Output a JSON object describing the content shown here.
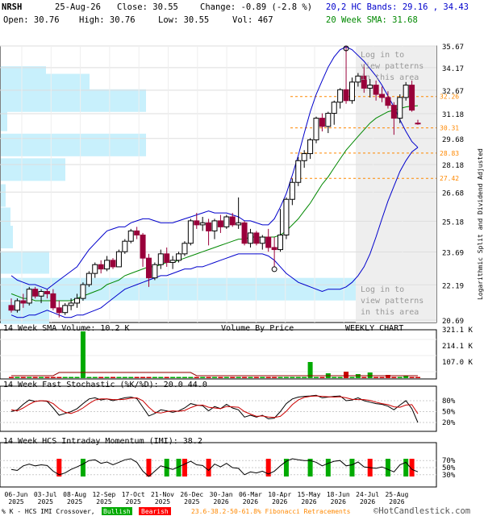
{
  "header": {
    "symbol": "NRSH",
    "date": "25-Aug-26",
    "close_label": "Close: 30.55",
    "change_label": "Change: -0.89 (-2.8 %)",
    "bands_label": "20,2 HC Bands: 29.16 , 34.43",
    "open_label": "Open: 30.76",
    "high_label": "High: 30.76",
    "low_label": "Low: 30.55",
    "vol_label": "Vol: 467",
    "sma_label": "20 Week SMA: 31.68"
  },
  "panels": {
    "volume_title": "14 Week SMA Volume: 10.2 K",
    "vbp_label": "Volume By Price",
    "weekly_label": "WEEKLY CHART",
    "stoch_title": "14 Week Fast Stochastic (%K/%D): 20.0 44.0",
    "imi_title": "14 Week HCS Intraday Momentum (IMI): 38.2",
    "side_label": "Logarithmic    Split and Dividend Adjusted",
    "login_top": [
      "Log in to",
      "view patterns",
      "in this area"
    ],
    "login_bottom": [
      "Log in to",
      "view patterns",
      "in this area"
    ]
  },
  "footer": {
    "legend_prefix": "% K - HCS IMI Crossover,",
    "bullish": "Bullish",
    "bearish": "Bearish",
    "fib": "23.6-38.2-50-61.8% Fibonacci Retracements",
    "copyright": "©HotCandlestick.com"
  },
  "colors": {
    "up_candle": "#ffffff",
    "down_candle": "#99003a",
    "bands": "#0000cc",
    "sma": "#008800",
    "vbp": "#c8f0fc",
    "fib": "#ff8800",
    "bullish": "#00aa00",
    "bearish": "#ff0000"
  },
  "chart_data": {
    "type": "candlestick",
    "scale": "log",
    "ylim": [
      20.69,
      35.67
    ],
    "price_ticks": [
      "35.67",
      "34.17",
      "32.67",
      "31.18",
      "29.68",
      "28.18",
      "26.68",
      "25.18",
      "23.69",
      "22.19",
      "20.69"
    ],
    "fib_levels": [
      {
        "label": "32.26",
        "value": 32.26
      },
      {
        "label": "30.31",
        "value": 30.31
      },
      {
        "label": "28.83",
        "value": 28.83
      },
      {
        "label": "27.42",
        "value": 27.42
      }
    ],
    "x_labels": [
      "06-Jun\n2025",
      "03-Jul\n2025",
      "08-Aug\n2025",
      "12-Sep\n2025",
      "17-Oct\n2025",
      "21-Nov\n2025",
      "26-Dec\n2025",
      "30-Jan\n2026",
      "06-Mar\n2026",
      "10-Apr\n2026",
      "15-May\n2026",
      "18-Jun\n2026",
      "24-Jul\n2026",
      "25-Aug\n2026"
    ],
    "candles": [
      [
        21.3,
        21.6,
        21.0,
        21.1
      ],
      [
        21.1,
        21.6,
        21.0,
        21.5
      ],
      [
        21.5,
        21.8,
        21.2,
        21.4
      ],
      [
        21.4,
        22.1,
        21.3,
        22.0
      ],
      [
        22.0,
        22.1,
        21.6,
        21.7
      ],
      [
        21.7,
        22.0,
        21.4,
        21.9
      ],
      [
        21.9,
        22.0,
        21.6,
        21.8
      ],
      [
        21.8,
        22.0,
        21.1,
        21.2
      ],
      [
        21.2,
        21.5,
        20.8,
        21.0
      ],
      [
        21.0,
        21.4,
        20.9,
        21.3
      ],
      [
        21.3,
        21.6,
        21.1,
        21.4
      ],
      [
        21.4,
        21.8,
        21.2,
        21.6
      ],
      [
        21.6,
        22.3,
        21.5,
        22.2
      ],
      [
        22.2,
        22.8,
        22.1,
        22.7
      ],
      [
        22.7,
        23.2,
        22.5,
        23.1
      ],
      [
        23.1,
        23.3,
        22.7,
        22.9
      ],
      [
        22.9,
        23.5,
        22.8,
        23.3
      ],
      [
        23.3,
        23.4,
        22.9,
        23.0
      ],
      [
        23.0,
        23.8,
        23.0,
        23.7
      ],
      [
        23.7,
        24.3,
        23.6,
        24.2
      ],
      [
        24.2,
        24.8,
        24.1,
        24.7
      ],
      [
        24.7,
        24.9,
        24.3,
        24.5
      ],
      [
        24.5,
        24.6,
        23.0,
        23.4
      ],
      [
        23.4,
        23.6,
        22.1,
        22.5
      ],
      [
        22.5,
        23.2,
        22.4,
        23.1
      ],
      [
        23.1,
        23.8,
        22.9,
        23.6
      ],
      [
        23.6,
        23.9,
        23.0,
        23.2
      ],
      [
        23.2,
        23.5,
        22.9,
        23.3
      ],
      [
        23.3,
        23.7,
        23.2,
        23.6
      ],
      [
        23.6,
        24.2,
        23.5,
        24.1
      ],
      [
        24.1,
        25.3,
        24.0,
        25.2
      ],
      [
        25.2,
        25.6,
        24.8,
        25.0
      ],
      [
        25.0,
        25.4,
        24.7,
        25.1
      ],
      [
        25.1,
        25.3,
        24.0,
        24.7
      ],
      [
        24.7,
        25.3,
        24.3,
        25.2
      ],
      [
        25.2,
        25.5,
        24.6,
        24.9
      ],
      [
        24.9,
        25.5,
        24.8,
        25.4
      ],
      [
        25.4,
        25.6,
        24.9,
        25.0
      ],
      [
        25.0,
        26.4,
        24.8,
        25.1
      ],
      [
        25.1,
        25.2,
        24.0,
        24.1
      ],
      [
        24.1,
        24.8,
        23.9,
        24.6
      ],
      [
        24.6,
        24.7,
        24.0,
        24.1
      ],
      [
        24.1,
        24.5,
        23.8,
        24.4
      ],
      [
        24.4,
        24.8,
        23.7,
        23.9
      ],
      [
        23.9,
        24.4,
        23.0,
        23.8
      ],
      [
        23.8,
        25.8,
        23.7,
        24.5
      ],
      [
        24.5,
        26.4,
        24.3,
        26.3
      ],
      [
        26.3,
        27.4,
        26.0,
        27.2
      ],
      [
        27.2,
        28.6,
        27.0,
        28.4
      ],
      [
        28.4,
        29.0,
        28.0,
        28.8
      ],
      [
        28.8,
        29.7,
        28.5,
        29.6
      ],
      [
        29.6,
        31.0,
        29.4,
        30.9
      ],
      [
        30.9,
        31.2,
        30.1,
        30.4
      ],
      [
        30.4,
        31.3,
        30.0,
        31.2
      ],
      [
        31.2,
        32.0,
        30.5,
        31.9
      ],
      [
        31.9,
        32.8,
        31.5,
        32.7
      ],
      [
        32.7,
        35.67,
        31.8,
        32.0
      ],
      [
        32.0,
        33.5,
        31.8,
        33.2
      ],
      [
        33.2,
        33.8,
        32.9,
        33.6
      ],
      [
        33.6,
        34.4,
        32.5,
        32.8
      ],
      [
        32.8,
        33.4,
        32.2,
        33.0
      ],
      [
        33.0,
        33.3,
        32.0,
        32.4
      ],
      [
        32.4,
        32.9,
        31.9,
        32.2
      ],
      [
        32.2,
        32.6,
        31.5,
        31.7
      ],
      [
        31.7,
        31.9,
        29.9,
        30.9
      ],
      [
        30.9,
        32.4,
        30.6,
        32.2
      ],
      [
        32.2,
        33.2,
        32.0,
        33.0
      ],
      [
        33.0,
        33.3,
        31.3,
        31.4
      ],
      [
        30.6,
        30.8,
        30.5,
        30.55
      ]
    ],
    "upper_band": [
      22.6,
      22.4,
      22.3,
      22.2,
      22.2,
      22.1,
      22.0,
      22.2,
      22.4,
      22.6,
      22.8,
      23.0,
      23.4,
      23.8,
      24.1,
      24.4,
      24.7,
      24.8,
      24.9,
      24.9,
      25.1,
      25.2,
      25.3,
      25.3,
      25.2,
      25.1,
      25.1,
      25.1,
      25.2,
      25.3,
      25.4,
      25.5,
      25.6,
      25.7,
      25.6,
      25.6,
      25.6,
      25.5,
      25.4,
      25.2,
      25.2,
      25.1,
      25.0,
      25.0,
      25.3,
      25.9,
      26.6,
      27.6,
      28.7,
      30.0,
      31.3,
      32.4,
      33.3,
      34.2,
      34.9,
      35.4,
      35.6,
      35.4,
      35.0,
      34.6,
      34.1,
      33.6,
      33.0,
      32.3,
      31.6,
      30.8,
      30.1,
      29.5,
      29.16
    ],
    "sma20": [
      21.8,
      21.7,
      21.6,
      21.6,
      21.5,
      21.5,
      21.5,
      21.5,
      21.5,
      21.5,
      21.5,
      21.6,
      21.7,
      21.8,
      21.9,
      22.0,
      22.2,
      22.3,
      22.4,
      22.6,
      22.7,
      22.8,
      22.9,
      23.0,
      23.0,
      23.1,
      23.2,
      23.2,
      23.3,
      23.4,
      23.5,
      23.6,
      23.7,
      23.8,
      23.9,
      24.0,
      24.1,
      24.2,
      24.3,
      24.3,
      24.4,
      24.4,
      24.4,
      24.4,
      24.4,
      24.5,
      24.7,
      25.0,
      25.3,
      25.7,
      26.1,
      26.6,
      27.1,
      27.5,
      28.0,
      28.5,
      29.0,
      29.4,
      29.8,
      30.2,
      30.6,
      30.9,
      31.1,
      31.3,
      31.4,
      31.5,
      31.6,
      31.65,
      31.68
    ],
    "lower_band": [
      20.9,
      20.8,
      20.8,
      20.9,
      20.9,
      21.0,
      21.1,
      21.0,
      20.9,
      20.8,
      20.8,
      20.9,
      20.9,
      21.0,
      21.1,
      21.2,
      21.4,
      21.6,
      21.8,
      22.0,
      22.1,
      22.2,
      22.3,
      22.4,
      22.5,
      22.6,
      22.6,
      22.7,
      22.8,
      22.9,
      22.9,
      23.0,
      23.0,
      23.1,
      23.2,
      23.3,
      23.4,
      23.5,
      23.6,
      23.6,
      23.6,
      23.6,
      23.6,
      23.5,
      23.3,
      23.0,
      22.7,
      22.5,
      22.3,
      22.2,
      22.1,
      22.0,
      21.9,
      22.0,
      22.0,
      22.0,
      22.1,
      22.3,
      22.6,
      23.0,
      23.6,
      24.4,
      25.3,
      26.2,
      27.0,
      27.8,
      28.4,
      28.9,
      29.16
    ],
    "vbp_bars": [
      {
        "price": 33.5,
        "len": 56
      },
      {
        "price": 33.0,
        "len": 110
      },
      {
        "price": 32.0,
        "len": 180
      },
      {
        "price": 30.8,
        "len": 8
      },
      {
        "price": 29.3,
        "len": 180
      },
      {
        "price": 27.9,
        "len": 80
      },
      {
        "price": 26.5,
        "len": 6
      },
      {
        "price": 25.3,
        "len": 12
      },
      {
        "price": 24.4,
        "len": 15
      },
      {
        "price": 23.2,
        "len": 60
      },
      {
        "price": 22.0,
        "len": 440
      },
      {
        "price": 21.0,
        "len": 60
      }
    ],
    "volume": [
      1.5,
      1.5,
      1.5,
      1.5,
      1.5,
      1.5,
      1.5,
      1.5,
      1.5,
      1.5,
      1.5,
      1.5,
      1.5,
      1.5,
      1.5,
      1.5,
      1.5,
      1.5,
      1.5,
      1.5,
      1.5,
      1.5,
      1.5,
      1.5,
      1.5,
      1.5,
      1.5,
      1.5,
      1.5,
      1.5,
      1.5,
      1.5,
      1.5,
      1.5,
      1.5,
      1.5,
      1.5,
      1.5,
      1.5,
      1.5,
      1.5,
      1.5,
      1.5,
      1.5,
      1.5,
      1.5,
      1.5,
      1.5,
      1.5,
      1.5,
      1.5,
      1.5,
      1.5,
      1.5,
      1.5,
      1.5,
      1.5,
      1.5,
      1.5,
      1.5,
      1.5,
      1.5,
      1.5,
      1.5,
      1.5,
      1.5,
      1.5,
      1.5,
      1.5
    ],
    "volume_ticks": [
      "321.1 K",
      "214.1 K",
      "107.0 K"
    ],
    "stoch_ticks": [
      "80%",
      "50%",
      "20%"
    ],
    "stoch_k": [
      50,
      55,
      70,
      82,
      78,
      80,
      78,
      60,
      40,
      45,
      50,
      58,
      72,
      85,
      88,
      82,
      85,
      80,
      84,
      88,
      90,
      86,
      62,
      38,
      45,
      55,
      52,
      48,
      52,
      60,
      72,
      68,
      66,
      52,
      64,
      58,
      70,
      60,
      55,
      35,
      40,
      35,
      40,
      30,
      32,
      50,
      72,
      85,
      90,
      92,
      93,
      95,
      88,
      90,
      92,
      93,
      80,
      82,
      88,
      80,
      76,
      72,
      70,
      65,
      55,
      68,
      80,
      58,
      20
    ],
    "stoch_d": [
      55,
      52,
      60,
      70,
      78,
      80,
      79,
      72,
      58,
      48,
      45,
      51,
      60,
      72,
      82,
      85,
      85,
      83,
      83,
      84,
      87,
      88,
      80,
      62,
      48,
      46,
      50,
      52,
      51,
      53,
      61,
      67,
      68,
      62,
      60,
      58,
      64,
      63,
      62,
      50,
      43,
      37,
      38,
      35,
      34,
      37,
      51,
      69,
      82,
      89,
      92,
      93,
      92,
      91,
      90,
      91,
      88,
      84,
      83,
      83,
      81,
      76,
      72,
      69,
      63,
      62,
      68,
      69,
      44
    ],
    "imi_ticks": [
      "70%",
      "50%",
      "30%"
    ],
    "imi": [
      45,
      42,
      55,
      60,
      55,
      58,
      56,
      40,
      30,
      35,
      45,
      52,
      60,
      70,
      72,
      62,
      66,
      58,
      65,
      72,
      75,
      65,
      40,
      25,
      40,
      55,
      50,
      45,
      52,
      60,
      68,
      58,
      56,
      42,
      60,
      52,
      62,
      50,
      48,
      30,
      38,
      35,
      40,
      32,
      40,
      55,
      68,
      75,
      72,
      70,
      70,
      65,
      55,
      62,
      68,
      70,
      55,
      58,
      66,
      52,
      50,
      48,
      52,
      45,
      38,
      58,
      65,
      45,
      38.2
    ],
    "imi_signals": [
      {
        "i": 8,
        "type": "bearish"
      },
      {
        "i": 12,
        "type": "bullish"
      },
      {
        "i": 23,
        "type": "bearish"
      },
      {
        "i": 26,
        "type": "bullish"
      },
      {
        "i": 28,
        "type": "bullish"
      },
      {
        "i": 29,
        "type": "bearish"
      },
      {
        "i": 33,
        "type": "bearish"
      },
      {
        "i": 43,
        "type": "bearish"
      },
      {
        "i": 46,
        "type": "bullish"
      },
      {
        "i": 50,
        "type": "bullish"
      },
      {
        "i": 53,
        "type": "bullish"
      },
      {
        "i": 57,
        "type": "bullish"
      },
      {
        "i": 60,
        "type": "bearish"
      },
      {
        "i": 63,
        "type": "bullish"
      },
      {
        "i": 66,
        "type": "bullish"
      },
      {
        "i": 67,
        "type": "bearish"
      }
    ]
  }
}
